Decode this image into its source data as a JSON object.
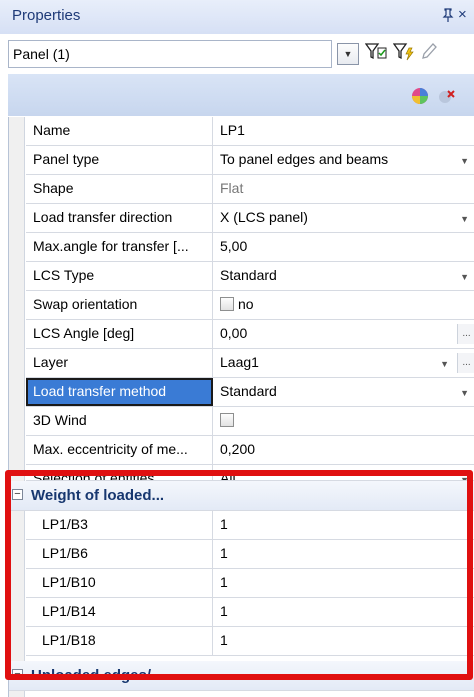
{
  "panel": {
    "title": "Properties",
    "pin_glyph": "ᵖ",
    "close_glyph": "×",
    "selector_value": "Panel (1)",
    "dropdown_glyph": "▼"
  },
  "properties": [
    {
      "name": "Name",
      "value": "LP1"
    },
    {
      "name": "Panel type",
      "value": "To panel edges and beams"
    },
    {
      "name": "Shape",
      "value": "Flat"
    },
    {
      "name": "Load transfer direction",
      "value": "X (LCS panel)"
    },
    {
      "name": "Max.angle for transfer [...",
      "value": "5,00"
    },
    {
      "name": "LCS Type",
      "value": "Standard"
    },
    {
      "name": "Swap orientation",
      "value": "no"
    },
    {
      "name": "LCS Angle [deg]",
      "value": "0,00"
    },
    {
      "name": "Layer",
      "value": "Laag1"
    },
    {
      "name": "Load transfer method",
      "value": "Standard"
    },
    {
      "name": "3D Wind",
      "value": ""
    },
    {
      "name": "Max. eccentricity of me...",
      "value": "0,200"
    },
    {
      "name": "Selection of entities",
      "value": "All"
    }
  ],
  "weight_group": {
    "title": "Weight of loaded...",
    "rows": [
      {
        "name": "LP1/B3",
        "value": "1"
      },
      {
        "name": "LP1/B6",
        "value": "1"
      },
      {
        "name": "LP1/B10",
        "value": "1"
      },
      {
        "name": "LP1/B14",
        "value": "1"
      },
      {
        "name": "LP1/B18",
        "value": "1"
      }
    ]
  },
  "unloaded_group": {
    "title": "Unloaded edges/..."
  },
  "colors": {
    "header_text": "#1e3a78",
    "selection": "#3a7bd5",
    "highlight_border": "#e01010"
  }
}
